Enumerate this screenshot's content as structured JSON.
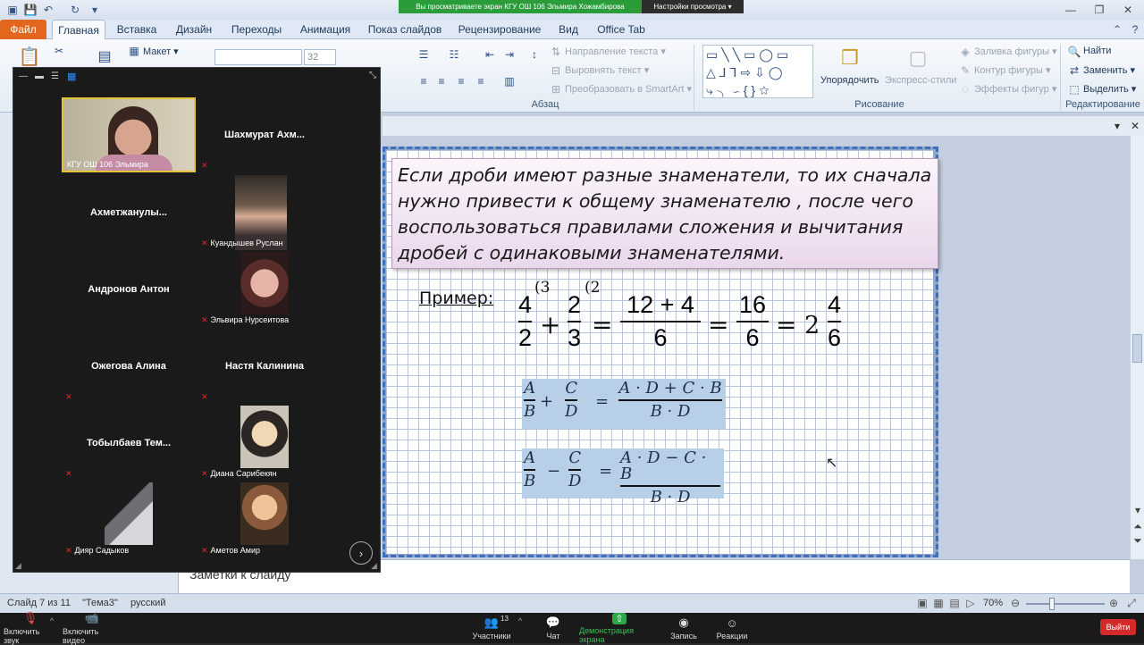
{
  "share_banner": {
    "text": "Вы просматриваете экран КГУ ОШ 106 Эльмира Хожамбирова",
    "view_settings": "Настройки просмотра ▾"
  },
  "ribbon_tabs": [
    "Файл",
    "Главная",
    "Вставка",
    "Дизайн",
    "Переходы",
    "Анимация",
    "Показ слайдов",
    "Рецензирование",
    "Вид",
    "Office Tab"
  ],
  "ribbon": {
    "layout": "Макет ▾",
    "font_size": "32",
    "text_direction": "Направление текста ▾",
    "align_text": "Выровнять текст ▾",
    "smartart": "Преобразовать в SmartArt ▾",
    "paragraph_group": "Абзац",
    "arrange": "Упорядочить",
    "quick_styles": "Экспресс-стили",
    "shape_fill": "Заливка фигуры ▾",
    "shape_outline": "Контур фигуры ▾",
    "shape_effects": "Эффекты фигур ▾",
    "drawing_group": "Рисование",
    "find": "Найти",
    "replace": "Заменить ▾",
    "select": "Выделить ▾",
    "editing_group": "Редактирование"
  },
  "gallery": {
    "tiles": [
      {
        "name": "",
        "caption": "КГУ ОШ 106 Эльмира"
      },
      {
        "name": "Шахмурат  Ахм...",
        "caption": ""
      },
      {
        "name": "Ахметжанулы...",
        "caption": ""
      },
      {
        "name": "",
        "caption": "Куандышев Руслан"
      },
      {
        "name": "Андронов Антон",
        "caption": ""
      },
      {
        "name": "",
        "caption": "Эльвира Нурсеитова"
      },
      {
        "name": "Ожегова Алина",
        "caption": ""
      },
      {
        "name": "Настя Калинина",
        "caption": ""
      },
      {
        "name": "Тобылбаев  Тем...",
        "caption": ""
      },
      {
        "name": "",
        "caption": "Диана Сарибекян"
      },
      {
        "name": "",
        "caption": "Дияр Садыков"
      },
      {
        "name": "",
        "caption": "Аметов Амир"
      }
    ]
  },
  "slide": {
    "rule": "Если дроби имеют разные знаменатели, то их сначала нужно привести к общему знаменателю , после чего воспользоваться правилами сложения и вычитания дробей с одинаковыми знаменателями.",
    "example_label": "Пример:",
    "example": {
      "f1_num": "4",
      "f1_den": "2",
      "f1_sup": "(3",
      "f2_num": "2",
      "f2_den": "3",
      "f2_sup": "(2",
      "plus": "+",
      "eq": "=",
      "f3_num": "12 + 4",
      "f3_den": "6",
      "f4_num": "16",
      "f4_den": "6",
      "whole": "2",
      "f5_num": "4",
      "f5_den": "6"
    },
    "formula_add": {
      "a": "A",
      "b": "B",
      "op": "+",
      "c": "C",
      "d": "D",
      "eq": "=",
      "rnum": "A · D + C · B",
      "rden": "B · D"
    },
    "formula_sub": {
      "a": "A",
      "b": "B",
      "op": "−",
      "c": "C",
      "d": "D",
      "eq": "=",
      "rnum": "A · D − C · B",
      "rden": "B · D"
    }
  },
  "notes_placeholder": "Заметки к слайду",
  "status": {
    "slide": "Слайд 7 из 11",
    "theme": "\"Тема3\"",
    "language": "русский",
    "zoom": "70%"
  },
  "zoom_toolbar": {
    "unmute": "Включить звук",
    "start_video": "Включить видео",
    "participants": "Участники",
    "participants_count": "13",
    "chat": "Чат",
    "share": "Демонстрация экрана",
    "record": "Запись",
    "reactions": "Реакции",
    "leave": "Выйти"
  }
}
